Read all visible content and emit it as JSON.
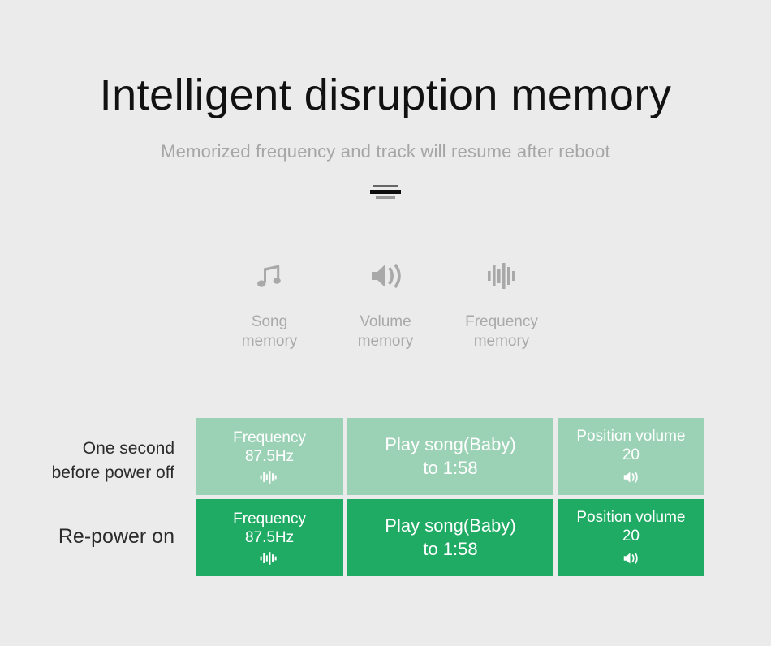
{
  "header": {
    "title": "Intelligent disruption memory",
    "subtitle": "Memorized frequency and track will resume after reboot"
  },
  "features": [
    {
      "icon": "music-note-icon",
      "label": "Song\nmemory"
    },
    {
      "icon": "speaker-volume-icon",
      "label": "Volume\nmemory"
    },
    {
      "icon": "waveform-frequency-icon",
      "label": "Frequency\nmemory"
    }
  ],
  "comparison": {
    "rows": [
      {
        "caption": "One second\nbefore power off",
        "state": "before-power-off",
        "cells": [
          {
            "text": "Frequency\n87.5Hz",
            "icon": "waveform-frequency-icon"
          },
          {
            "text": "Play song(Baby)\nto 1:58",
            "icon": ""
          },
          {
            "text": "Position volume\n20",
            "icon": "speaker-volume-icon"
          }
        ]
      },
      {
        "caption": "Re-power on",
        "state": "re-power-on",
        "cells": [
          {
            "text": "Frequency\n87.5Hz",
            "icon": "waveform-frequency-icon"
          },
          {
            "text": "Play song(Baby)\nto 1:58",
            "icon": ""
          },
          {
            "text": "Position volume\n20",
            "icon": "speaker-volume-icon"
          }
        ]
      }
    ]
  },
  "colors": {
    "background": "#ecebeb",
    "title": "#111111",
    "subtitle": "#a6a6a6",
    "feature_gray": "#a9a9a9",
    "row_light_green": "#9bd2b5",
    "row_dark_green": "#1fab64",
    "cell_text": "#ffffff"
  }
}
